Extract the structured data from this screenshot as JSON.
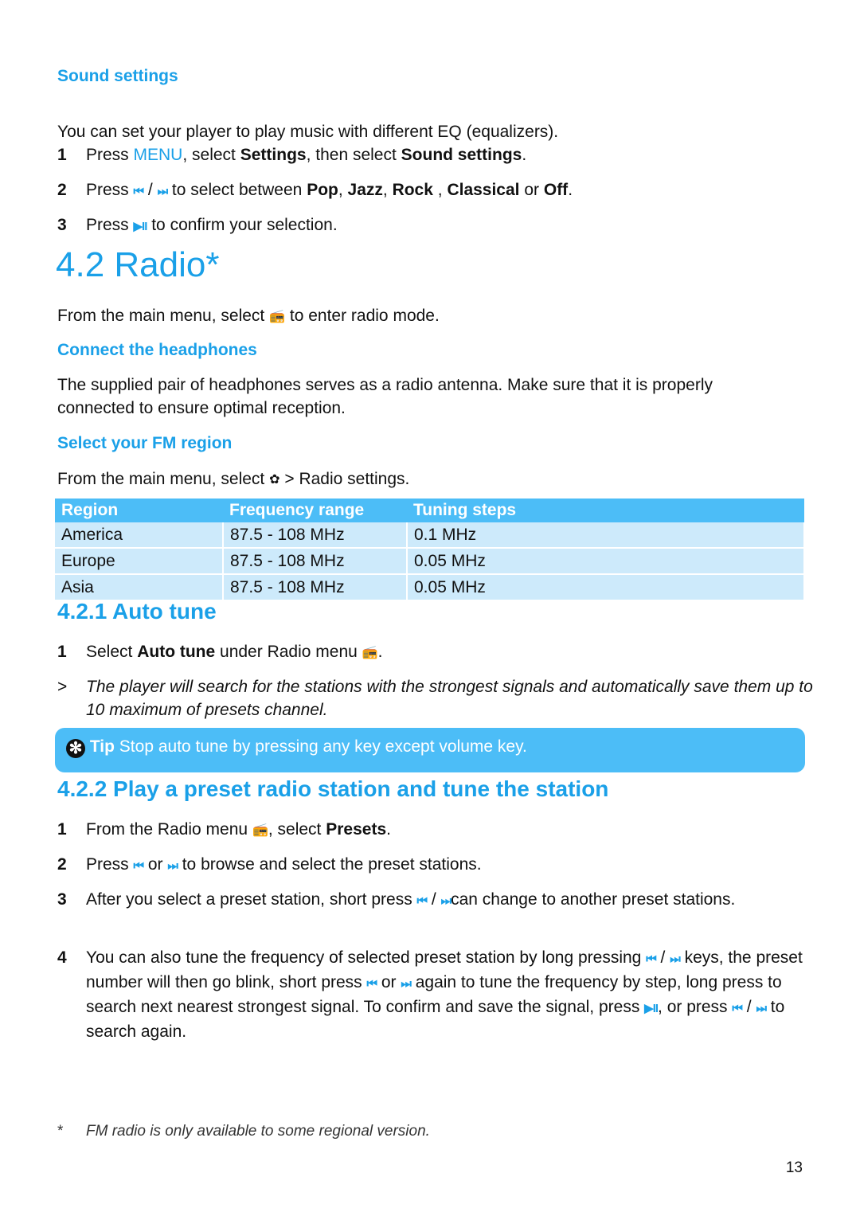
{
  "sound_settings": {
    "heading": "Sound settings",
    "intro": "You can set your player to play music with different EQ (equalizers).",
    "steps": [
      {
        "num": "1",
        "parts": [
          "Press ",
          "MENU",
          ", select ",
          "Settings",
          ", then select ",
          "Sound settings",
          "."
        ]
      },
      {
        "num": "2",
        "parts": [
          "Press ",
          "/",
          " to select between ",
          "Pop",
          ", ",
          "Jazz",
          ", ",
          "Rock",
          " , ",
          "Classical",
          " or ",
          "Off",
          "."
        ]
      },
      {
        "num": "3",
        "parts": [
          "Press ",
          " to confirm your selection."
        ]
      }
    ]
  },
  "radio": {
    "title": "4.2  Radio*",
    "intro_before": "From the main menu, select ",
    "intro_after": " to enter radio mode.",
    "connect_heading": "Connect the headphones",
    "connect_text": "The supplied pair of headphones serves as a radio antenna. Make sure that it is properly connected to ensure optimal reception.",
    "region_heading": "Select your FM region",
    "region_before": "From the main menu, select ",
    "region_after": " > Radio settings.",
    "table": {
      "headers": [
        "Region",
        "Frequency range",
        "Tuning steps"
      ],
      "rows": [
        [
          "America",
          "87.5 - 108 MHz",
          "0.1 MHz"
        ],
        [
          "Europe",
          "87.5 - 108 MHz",
          "0.05 MHz"
        ],
        [
          "Asia",
          "87.5 - 108 MHz",
          "0.05 MHz"
        ]
      ]
    }
  },
  "auto_tune": {
    "heading": "4.2.1 Auto tune",
    "step1": {
      "num": "1",
      "before": "Select ",
      "bold": "Auto tune",
      "after": " under Radio menu "
    },
    "result_marker": ">",
    "result_text": "The player will search for the stations with the strongest signals and automatically save them up to 10 maximum of presets channel.",
    "tip_label": "Tip",
    "tip_text": " Stop auto tune by pressing any key except volume key."
  },
  "preset": {
    "heading": "4.2.2 Play a preset radio station and tune the station",
    "step1": {
      "num": "1",
      "before": "From the Radio menu ",
      "mid": ", select ",
      "bold": "Presets",
      "after": "."
    },
    "step2": {
      "num": "2",
      "a": "Press ",
      "b": " or ",
      "c": " to browse and select the preset stations."
    },
    "step3": {
      "num": "3",
      "a": "After you select a preset station, short press ",
      "b": " / ",
      "c": "can change to another preset stations."
    },
    "step4": {
      "num": "4",
      "a": "You can also tune the frequency of selected preset station by long pressing ",
      "b": " / ",
      "c": " keys, the preset number will then go blink, short press ",
      "d": " or ",
      "e": " again to tune the frequency by step, long press to search next nearest strongest signal. To confirm and save the signal, press ",
      "f": ", or press ",
      "g": " / ",
      "h": " to search again."
    }
  },
  "footnote": {
    "marker": "*",
    "text": "FM radio is only available to some regional version."
  },
  "page_number": "13",
  "icons": {
    "prev": "⏮",
    "next": "⏭",
    "play_pause": "▶II",
    "radio": "📻",
    "settings": "✿",
    "tip": "✻"
  }
}
